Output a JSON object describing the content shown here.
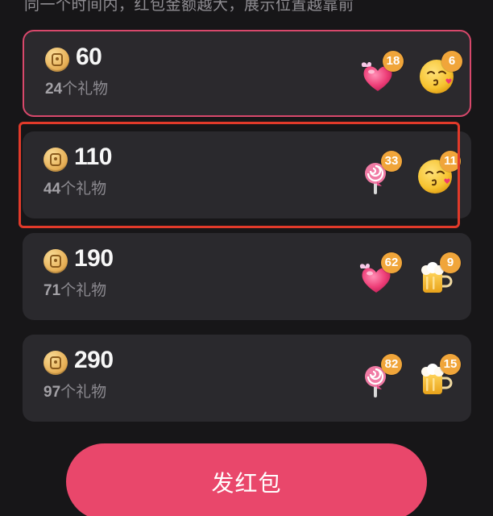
{
  "hint": "同一个时间内，红包金额越大，展示位置越靠前",
  "gift_unit": "个礼物",
  "packets": [
    {
      "amount": "60",
      "gift_count": "24",
      "selected": true,
      "gifts": [
        {
          "icon": "heart-gift-icon",
          "count": "18"
        },
        {
          "icon": "kiss-face-gift-icon",
          "count": "6"
        }
      ]
    },
    {
      "amount": "110",
      "gift_count": "44",
      "selected": false,
      "gifts": [
        {
          "icon": "lollipop-gift-icon",
          "count": "33"
        },
        {
          "icon": "kiss-face-gift-icon",
          "count": "11"
        }
      ]
    },
    {
      "amount": "190",
      "gift_count": "71",
      "selected": false,
      "gifts": [
        {
          "icon": "heart-gift-icon",
          "count": "62"
        },
        {
          "icon": "beer-mug-gift-icon",
          "count": "9"
        }
      ]
    },
    {
      "amount": "290",
      "gift_count": "97",
      "selected": false,
      "gifts": [
        {
          "icon": "lollipop-gift-icon",
          "count": "82"
        },
        {
          "icon": "beer-mug-gift-icon",
          "count": "15"
        }
      ]
    }
  ],
  "send_button": "发红包",
  "colors": {
    "background": "#171618",
    "card": "#2a292d",
    "selected_border": "#d8486b",
    "highlight_frame": "#e13a2a",
    "badge": "#f0a53a",
    "button": "#e9476b"
  }
}
